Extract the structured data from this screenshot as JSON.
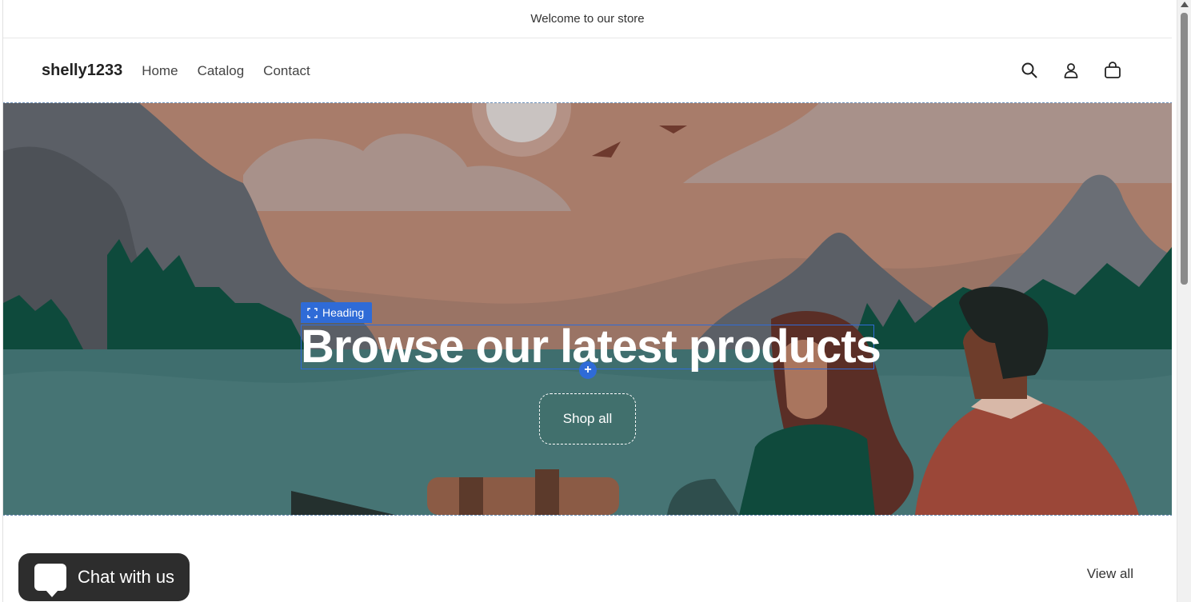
{
  "announcement": {
    "text": "Welcome to our store"
  },
  "header": {
    "logo": "shelly1233",
    "nav": [
      {
        "label": "Home"
      },
      {
        "label": "Catalog"
      },
      {
        "label": "Contact"
      }
    ],
    "icons": [
      "search-icon",
      "account-icon",
      "cart-icon"
    ]
  },
  "hero": {
    "editor_tag": "Heading",
    "heading": "Browse our latest products",
    "button_label": "Shop all",
    "add_block_symbol": "+"
  },
  "collection": {
    "view_all_label": "View all"
  },
  "chat": {
    "label": "Chat with us"
  },
  "colors": {
    "editor_accent": "#2f6bd7",
    "chat_bg": "#2d2d2d",
    "lake": "#3f6e6e",
    "sky": "#a5776a"
  }
}
